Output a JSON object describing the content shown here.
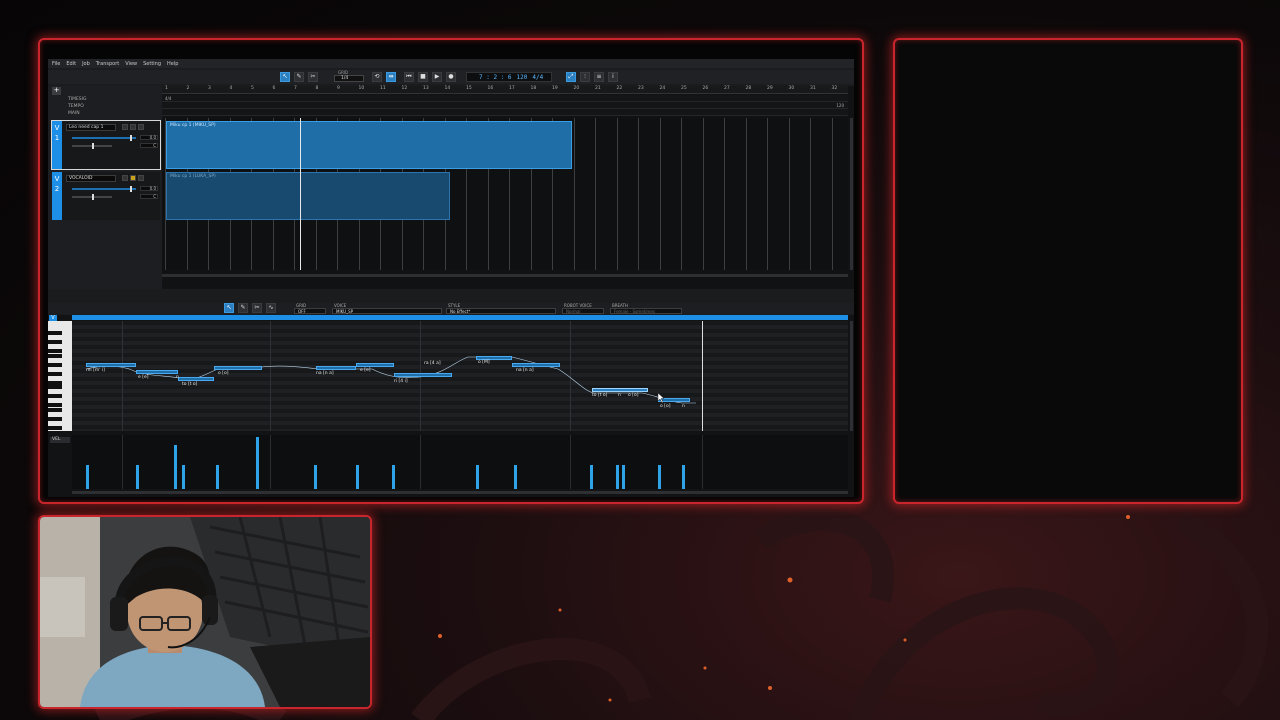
{
  "menu": [
    "File",
    "Edit",
    "Job",
    "Transport",
    "View",
    "Setting",
    "Help"
  ],
  "toolbar": {
    "grid_label": "GRID",
    "grid_value": "1/4",
    "position": "7 : 2 : 6",
    "tempo": "120",
    "time_signature": "4/4"
  },
  "arrange": {
    "rows": [
      "TIMESIG",
      "TEMPO",
      "MAIN"
    ],
    "timesig_value": "4/4",
    "tempo_value": "120",
    "ruler_numbers": [
      "1",
      "2",
      "3",
      "4",
      "5",
      "6",
      "7",
      "8",
      "9",
      "10",
      "11",
      "12",
      "13",
      "14",
      "15",
      "16",
      "17",
      "18",
      "19",
      "20",
      "21",
      "22",
      "23",
      "24",
      "25",
      "26",
      "27",
      "28",
      "29",
      "30",
      "31",
      "32"
    ],
    "tracks": [
      {
        "number": "1",
        "tag": "V",
        "name": "Leo need cap 1",
        "value": "0.0",
        "value2": "C",
        "part_label": "Miku cp 1 (MIKU_SP)"
      },
      {
        "number": "2",
        "tag": "V",
        "name": "VOCALOID",
        "value": "0.0",
        "value2": "C",
        "part_label": "Miku cp 1 (LUKA_SP)"
      }
    ]
  },
  "editor": {
    "tag": "V",
    "grid_label": "GRID",
    "grid_value": "OFF",
    "voice_label": "VOICE",
    "voice_value": "MIKU_SP",
    "style_label": "STYLE",
    "style_value": "No Effect*",
    "robot_label": "ROBOT VOICE",
    "robot_value": "Normal",
    "breath_label": "BREATH",
    "breath_value": "Female - Sometimes",
    "velocity_label": "VEL",
    "lyrics": [
      "mi [m' i]",
      "e [e]",
      "n",
      "to [t o]",
      "o [o]",
      "na [n a]",
      "ri [4 i]",
      "e [e]",
      "ra [4 a]",
      "o [M]",
      "na [n a]",
      "to [t o]",
      "n",
      "o [o]",
      "o [o]",
      "n"
    ]
  },
  "colors": {
    "frame": "#c8262c",
    "accent": "#1e8fe6",
    "part": "#1f6ea8"
  }
}
